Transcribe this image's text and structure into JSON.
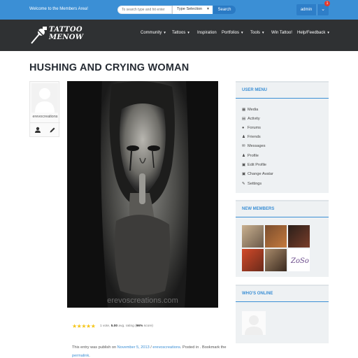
{
  "topbar": {
    "welcome": "Welcome to the Members Area!",
    "search_placeholder": "To search type and hit enter",
    "type_select": "Type Selection",
    "search_label": "Search",
    "admin_label": "admin",
    "notification_count": "1"
  },
  "brand": {
    "line1": "TATTOO",
    "line2": "MENOW"
  },
  "nav": {
    "items": [
      {
        "label": "Community",
        "caret": "▼"
      },
      {
        "label": "Tattoos",
        "caret": "▼"
      },
      {
        "label": "Inspiration",
        "caret": ""
      },
      {
        "label": "Portfolios",
        "caret": "▼"
      },
      {
        "label": "Tools",
        "caret": "▼"
      },
      {
        "label": "Win Tattoo!",
        "caret": ""
      },
      {
        "label": "Help/Feedback",
        "caret": "▼"
      }
    ]
  },
  "post": {
    "title": "HUSHING AND CRYING WOMAN",
    "author": "erevocreations",
    "watermark": "erevoscreations.com",
    "rating": {
      "stars": "★★★★★",
      "prefix": "1 vote, ",
      "score": "5.00",
      "suffix": " avg. rating (",
      "percent": "96%",
      "end": " score)"
    },
    "entry": {
      "prefix": "This entry was publish on ",
      "date": "November 5, 2013",
      "sep": " / ",
      "author": "erevoscreations",
      "middle": ". Posted in . Bookmark the",
      "permalink": "permalink",
      "end": "."
    }
  },
  "sidebar": {
    "user_menu": {
      "title": "USER MENU",
      "items": [
        {
          "icon": "▦",
          "label": "Media"
        },
        {
          "icon": "▤",
          "label": "Activity"
        },
        {
          "icon": "●",
          "label": "Forums"
        },
        {
          "icon": "♟",
          "label": "Friends"
        },
        {
          "icon": "✉",
          "label": "Messages"
        },
        {
          "icon": "♟",
          "label": "Profile"
        },
        {
          "icon": "▣",
          "label": "Edit Profile"
        },
        {
          "icon": "▣",
          "label": "Change Avatar"
        },
        {
          "icon": "✎",
          "label": "Settings"
        }
      ]
    },
    "new_members": {
      "title": "NEW MEMBERS"
    },
    "whos_online": {
      "title": "WHO'S ONLINE"
    }
  },
  "colors": {
    "accent": "#3b8fd5",
    "topbar": "#3b8fd5",
    "navbar": "#2f3133",
    "title": "#252b33",
    "star": "#f5c518"
  }
}
